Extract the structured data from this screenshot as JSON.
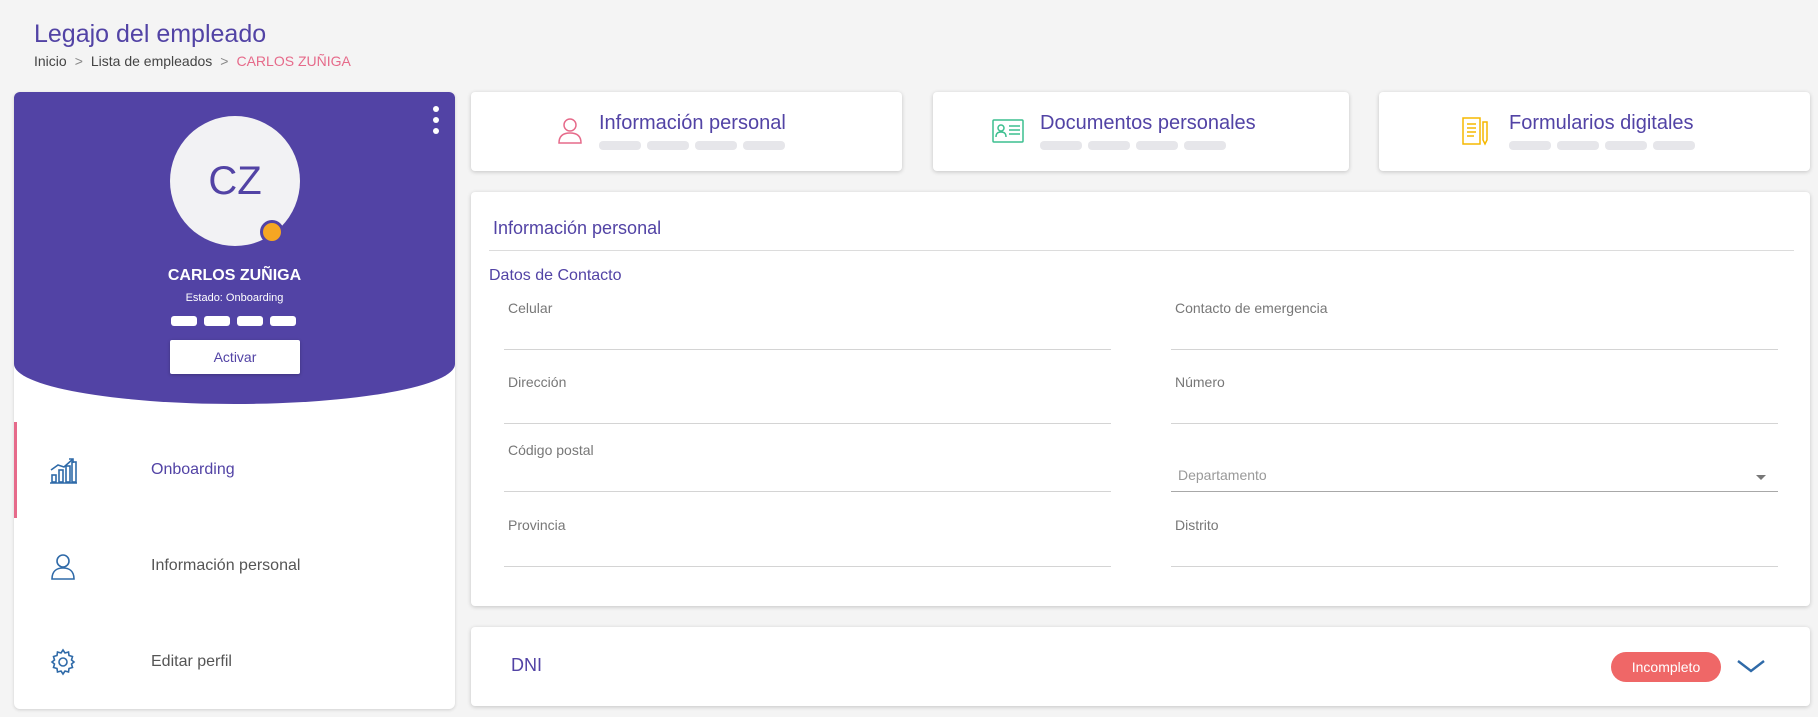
{
  "header": {
    "title": "Legajo del empleado",
    "breadcrumb": [
      "Inicio",
      "Lista de empleados",
      "CARLOS ZUÑIGA"
    ],
    "breadcrumb_separator": ">"
  },
  "profile": {
    "initials": "CZ",
    "name": "CARLOS ZUÑIGA",
    "status": "Estado: Onboarding",
    "status_color": "#f5a623",
    "activate_label": "Activar",
    "menu_icon": "more-vertical-icon"
  },
  "sidebar": {
    "items": [
      {
        "label": "Onboarding",
        "icon": "chart-growth-icon",
        "active": true
      },
      {
        "label": "Información personal",
        "icon": "user-icon",
        "active": false
      },
      {
        "label": "Editar perfil",
        "icon": "gear-icon",
        "active": false
      }
    ]
  },
  "cards": [
    {
      "label": "Información personal",
      "icon": "user-icon",
      "icon_color": "#e66a8a"
    },
    {
      "label": "Documentos personales",
      "icon": "id-card-icon",
      "icon_color": "#3cbf8f"
    },
    {
      "label": "Formularios digitales",
      "icon": "document-edit-icon",
      "icon_color": "#f5b800"
    }
  ],
  "info": {
    "title": "Información personal",
    "section": "Datos de Contacto",
    "fields": {
      "celular": "Celular",
      "contacto_emergencia": "Contacto de emergencia",
      "direccion": "Dirección",
      "numero": "Número",
      "codigo_postal": "Código postal",
      "departamento": "Departamento",
      "provincia": "Provincia",
      "distrito": "Distrito"
    }
  },
  "dni": {
    "title": "DNI",
    "badge": "Incompleto",
    "badge_color": "#ef6767"
  },
  "colors": {
    "brand": "#5243a5",
    "accent": "#e66a8a"
  }
}
